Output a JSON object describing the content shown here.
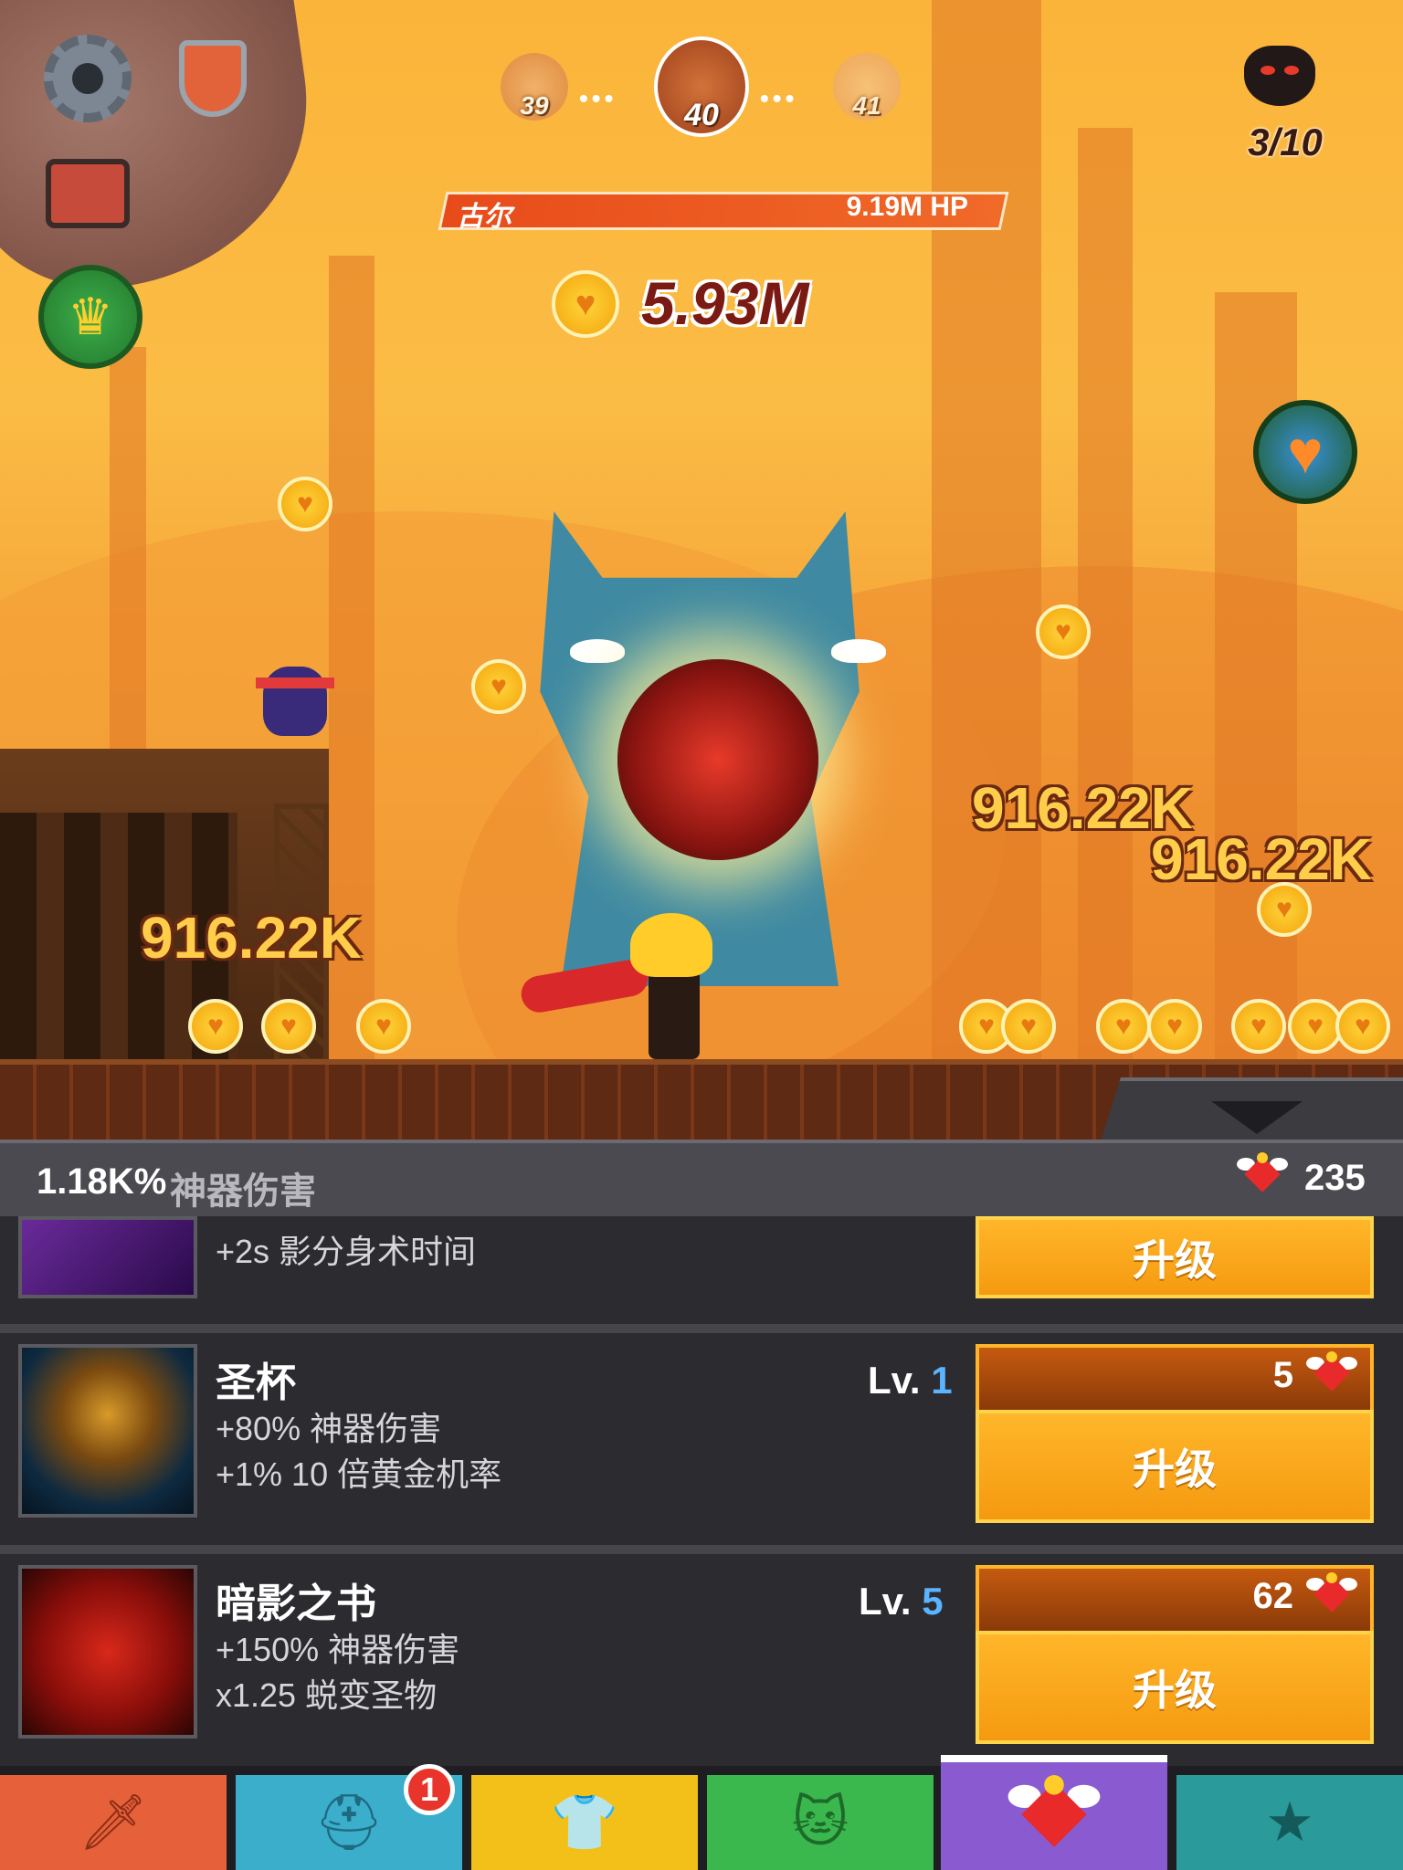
{
  "stage": {
    "prev": "39",
    "current": "40",
    "next": "41"
  },
  "boss_counter": "3/10",
  "boss": {
    "name": "古尔",
    "hp": "9.19M HP"
  },
  "gold_total": "5.93M",
  "damage_popups": [
    "916.22K",
    "916.22K",
    "916.22K"
  ],
  "panel": {
    "artifact_damage_value": "1.18K%",
    "artifact_damage_label": "神器伤害",
    "relic_count": "235"
  },
  "artifacts": [
    {
      "name": "",
      "lines": [
        "+2s 影分身术时间"
      ],
      "level_prefix": "",
      "level": "",
      "cost": "",
      "button": "升级"
    },
    {
      "name": "圣杯",
      "lines": [
        "+80% 神器伤害",
        "+1% 10 倍黄金机率"
      ],
      "level_prefix": "Lv.",
      "level": "1",
      "cost": "5",
      "button": "升级"
    },
    {
      "name": "暗影之书",
      "lines": [
        "+150% 神器伤害",
        "x1.25 蜕变圣物"
      ],
      "level_prefix": "Lv.",
      "level": "5",
      "cost": "62",
      "button": "升级"
    }
  ],
  "tabs": [
    {
      "name": "sword",
      "icon": "sword-icon",
      "color": "#e6603a"
    },
    {
      "name": "heroes",
      "icon": "helmet-icon",
      "color": "#3aaecb",
      "badge": "1"
    },
    {
      "name": "equipment",
      "icon": "shirt-icon",
      "color": "#f2c018"
    },
    {
      "name": "pets",
      "icon": "pet-icon",
      "color": "#3ab84e"
    },
    {
      "name": "artifacts",
      "icon": "winged-heart-icon",
      "color": "#8a5ad0"
    },
    {
      "name": "shop",
      "icon": "star-icon",
      "color": "#2a9a9a"
    }
  ]
}
